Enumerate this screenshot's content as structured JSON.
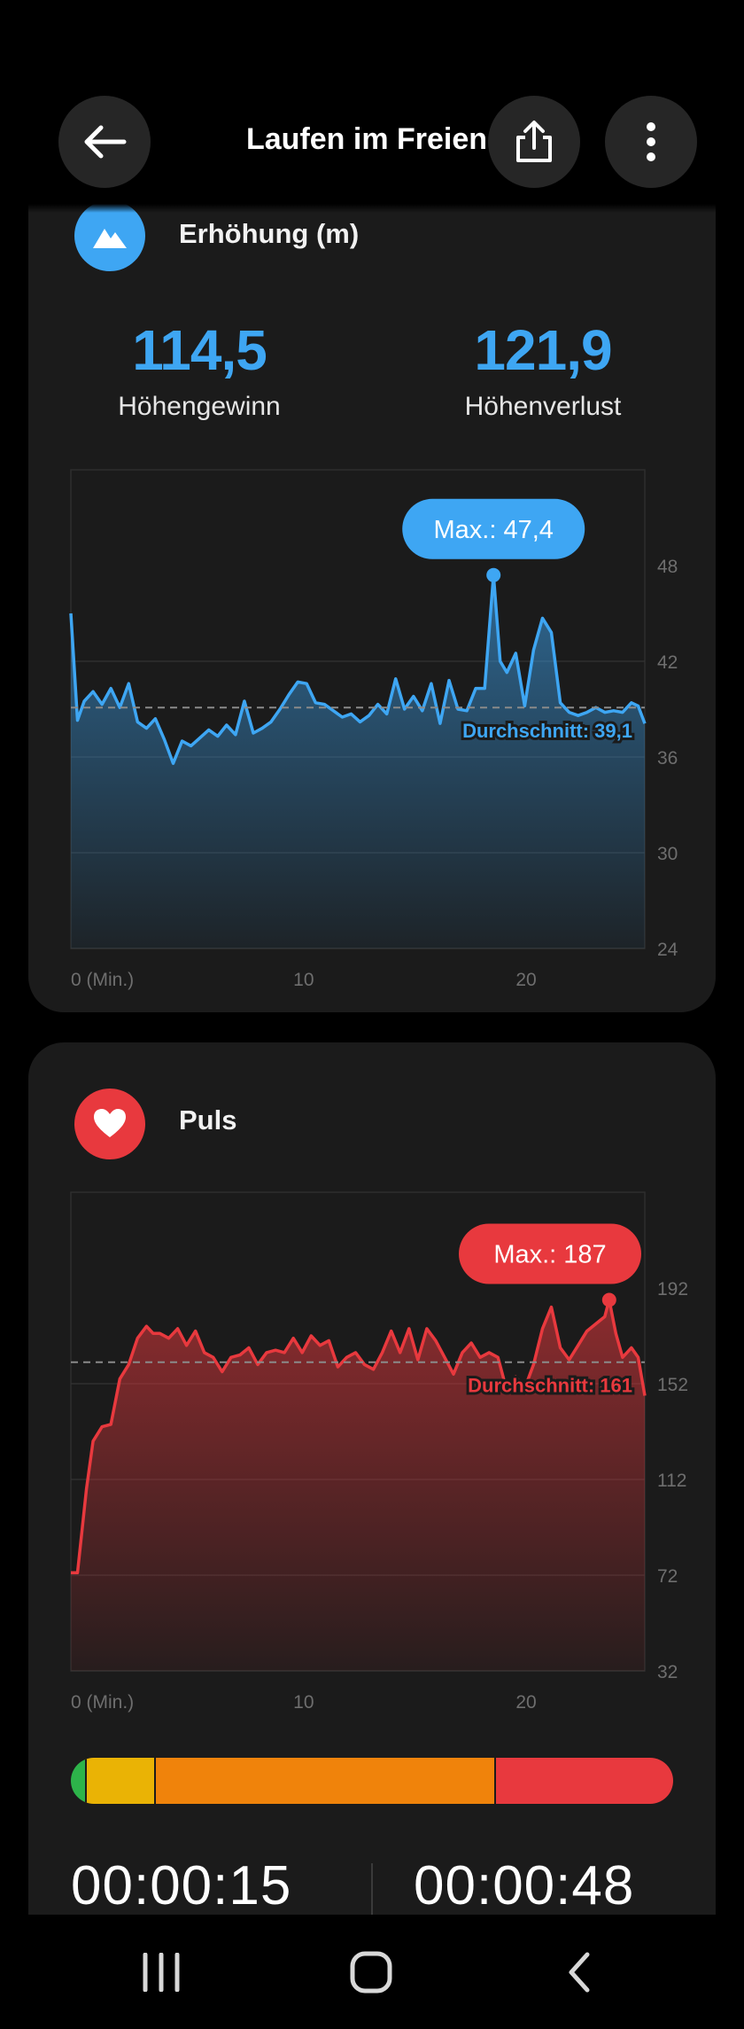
{
  "header": {
    "title": "Laufen im Freien",
    "back_icon": "arrow-left-icon",
    "share_icon": "share-icon",
    "more_icon": "more-vertical-icon"
  },
  "elevation": {
    "title": "Erhöhung (m)",
    "icon": "mountain-icon",
    "accent_color": "#3ea6f3",
    "gain_value": "114,5",
    "gain_label": "Höhengewinn",
    "loss_value": "121,9",
    "loss_label": "Höhenverlust"
  },
  "pulse": {
    "title": "Puls",
    "icon": "heart-icon",
    "accent_color": "#e8393e"
  },
  "chart_data": [
    {
      "type": "area",
      "title": "Erhöhung (m)",
      "xlabel": "",
      "ylabel": "",
      "x_unit": "Min.",
      "x_ticks": [
        "0 (Min.)",
        "10",
        "20"
      ],
      "x_tick_values": [
        0,
        10,
        20
      ],
      "xlim": [
        0,
        25.8
      ],
      "y_ticks": [
        "48",
        "42",
        "36",
        "30",
        "24"
      ],
      "ylim": [
        24,
        54
      ],
      "grid": true,
      "color": "#3ea6f3",
      "max_label": "Max.: 47,4",
      "avg_label": "Durchschnitt: 39,1",
      "max": 47.4,
      "max_x": 19.0,
      "average": 39.1,
      "x": [
        0,
        0.3,
        0.6,
        1,
        1.4,
        1.8,
        2.2,
        2.6,
        3,
        3.4,
        3.8,
        4.2,
        4.6,
        5,
        5.4,
        5.8,
        6.2,
        6.6,
        7,
        7.4,
        7.8,
        8.2,
        8.6,
        9,
        9.4,
        9.8,
        10.2,
        10.6,
        11,
        11.4,
        11.8,
        12.2,
        12.6,
        13,
        13.4,
        13.8,
        14.2,
        14.6,
        15,
        15.4,
        15.8,
        16.2,
        16.6,
        17,
        17.4,
        17.8,
        18.2,
        18.6,
        19.0,
        19.3,
        19.6,
        20,
        20.4,
        20.8,
        21.2,
        21.6,
        22,
        22.4,
        22.8,
        23.2,
        23.6,
        24,
        24.4,
        24.8,
        25.2,
        25.5,
        25.8
      ],
      "values": [
        45,
        38.3,
        39.5,
        40.1,
        39.3,
        40.3,
        39.1,
        40.6,
        38.2,
        37.8,
        38.4,
        37.1,
        35.6,
        37.0,
        36.7,
        37.2,
        37.7,
        37.3,
        38.0,
        37.4,
        39.5,
        37.5,
        37.8,
        38.2,
        39.0,
        39.9,
        40.7,
        40.6,
        39.4,
        39.3,
        38.9,
        38.5,
        38.7,
        38.2,
        38.6,
        39.3,
        38.7,
        40.9,
        39.0,
        39.8,
        38.9,
        40.6,
        38.1,
        40.8,
        39.0,
        38.9,
        40.3,
        40.3,
        47.4,
        42.0,
        41.3,
        42.5,
        39.2,
        42.7,
        44.7,
        43.8,
        39.4,
        38.8,
        38.6,
        38.8,
        39.1,
        38.8,
        38.9,
        38.8,
        39.4,
        39.2,
        38.1
      ]
    },
    {
      "type": "area",
      "title": "Puls",
      "xlabel": "",
      "ylabel": "",
      "x_unit": "Min.",
      "x_ticks": [
        "0 (Min.)",
        "10",
        "20"
      ],
      "x_tick_values": [
        0,
        10,
        20
      ],
      "xlim": [
        0,
        25.8
      ],
      "y_ticks": [
        "192",
        "152",
        "112",
        "72",
        "32"
      ],
      "ylim": [
        32,
        232
      ],
      "grid": true,
      "color": "#e8393e",
      "max_label": "Max.: 187",
      "avg_label": "Durchschnitt: 161",
      "max": 187,
      "max_x": 24.2,
      "average": 161,
      "x": [
        0,
        0.3,
        0.7,
        1,
        1.4,
        1.8,
        2.2,
        2.6,
        3,
        3.4,
        3.7,
        4.0,
        4.4,
        4.8,
        5.2,
        5.6,
        6.0,
        6.4,
        6.8,
        7.2,
        7.6,
        8.0,
        8.4,
        8.8,
        9.2,
        9.6,
        10.0,
        10.4,
        10.8,
        11.2,
        11.6,
        12.0,
        12.4,
        12.8,
        13.2,
        13.6,
        14.0,
        14.4,
        14.8,
        15.2,
        15.6,
        16.0,
        16.4,
        16.8,
        17.2,
        17.6,
        18.0,
        18.4,
        18.8,
        19.2,
        19.6,
        20.0,
        20.4,
        20.8,
        21.2,
        21.6,
        22.0,
        22.4,
        22.8,
        23.2,
        23.6,
        24.0,
        24.2,
        24.5,
        24.8,
        25.2,
        25.5,
        25.8
      ],
      "values": [
        73,
        73,
        108,
        128,
        134,
        135,
        154,
        160,
        171,
        176,
        173,
        173,
        171,
        175,
        168,
        174,
        165,
        163,
        157,
        163,
        164,
        167,
        160,
        165,
        166,
        165,
        171,
        165,
        172,
        168,
        170,
        159,
        163,
        165,
        160,
        158,
        165,
        174,
        165,
        175,
        162,
        175,
        170,
        163,
        156,
        165,
        169,
        163,
        165,
        163,
        149,
        155,
        150,
        160,
        175,
        184,
        167,
        162,
        168,
        174,
        177,
        180,
        187,
        173,
        163,
        167,
        163,
        147
      ]
    }
  ],
  "zones": [
    {
      "color": "#2db34a",
      "fraction": 0.023
    },
    {
      "color": "#eab305",
      "fraction": 0.115
    },
    {
      "color": "#f0830b",
      "fraction": 0.565
    },
    {
      "color": "#e8393e",
      "fraction": 0.297
    }
  ],
  "times": {
    "left": "00:00:15",
    "right": "00:00:48"
  },
  "nav": {
    "recents_icon": "recent-apps-icon",
    "home_icon": "home-icon",
    "back_icon": "back-chevron-icon"
  }
}
